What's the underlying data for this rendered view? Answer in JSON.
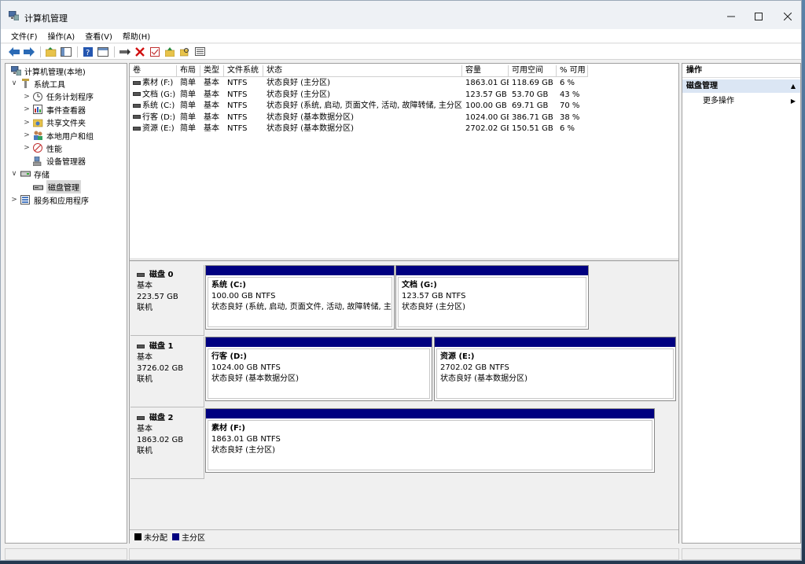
{
  "window": {
    "title": "计算机管理"
  },
  "menu": [
    "文件(F)",
    "操作(A)",
    "查看(V)",
    "帮助(H)"
  ],
  "tree": [
    {
      "label": "计算机管理(本地)",
      "level": 0,
      "expand": "",
      "icon": "computer-icon"
    },
    {
      "label": "系统工具",
      "level": 1,
      "expand": "∨",
      "icon": "tools-icon"
    },
    {
      "label": "任务计划程序",
      "level": 2,
      "expand": ">",
      "icon": "clock-icon"
    },
    {
      "label": "事件查看器",
      "level": 2,
      "expand": ">",
      "icon": "event-viewer-icon"
    },
    {
      "label": "共享文件夹",
      "level": 2,
      "expand": ">",
      "icon": "shared-folder-icon"
    },
    {
      "label": "本地用户和组",
      "level": 2,
      "expand": ">",
      "icon": "users-icon"
    },
    {
      "label": "性能",
      "level": 2,
      "expand": ">",
      "icon": "performance-icon"
    },
    {
      "label": "设备管理器",
      "level": 2,
      "expand": "",
      "icon": "device-manager-icon"
    },
    {
      "label": "存储",
      "level": 1,
      "expand": "∨",
      "icon": "storage-icon"
    },
    {
      "label": "磁盘管理",
      "level": 2,
      "expand": "",
      "icon": "disk-management-icon",
      "selected": true
    },
    {
      "label": "服务和应用程序",
      "level": 1,
      "expand": ">",
      "icon": "services-icon"
    }
  ],
  "volume_table": {
    "headers": [
      "卷",
      "布局",
      "类型",
      "文件系统",
      "状态",
      "容量",
      "可用空间",
      "% 可用"
    ],
    "rows": [
      [
        "素材 (F:)",
        "简单",
        "基本",
        "NTFS",
        "状态良好 (主分区)",
        "1863.01 GB",
        "118.69 GB",
        "6 %"
      ],
      [
        "文档 (G:)",
        "简单",
        "基本",
        "NTFS",
        "状态良好 (主分区)",
        "123.57 GB",
        "53.70 GB",
        "43 %"
      ],
      [
        "系统 (C:)",
        "简单",
        "基本",
        "NTFS",
        "状态良好 (系统, 启动, 页面文件, 活动, 故障转储, 主分区)",
        "100.00 GB",
        "69.71 GB",
        "70 %"
      ],
      [
        "行客 (D:)",
        "简单",
        "基本",
        "NTFS",
        "状态良好 (基本数据分区)",
        "1024.00 GB",
        "386.71 GB",
        "38 %"
      ],
      [
        "资源 (E:)",
        "简单",
        "基本",
        "NTFS",
        "状态良好 (基本数据分区)",
        "2702.02 GB",
        "150.51 GB",
        "6 %"
      ]
    ]
  },
  "disks": [
    {
      "name": "磁盘 0",
      "type": "基本",
      "size": "223.57 GB",
      "status": "联机",
      "partitions": [
        {
          "name": "系统  (C:)",
          "size": "100.00 GB NTFS",
          "status": "状态良好 (系统, 启动, 页面文件, 活动, 故障转储, 主分区)"
        },
        {
          "name": "文档  (G:)",
          "size": "123.57 GB NTFS",
          "status": "状态良好 (主分区)"
        }
      ]
    },
    {
      "name": "磁盘 1",
      "type": "基本",
      "size": "3726.02 GB",
      "status": "联机",
      "partitions": [
        {
          "name": "行客  (D:)",
          "size": "1024.00 GB NTFS",
          "status": "状态良好 (基本数据分区)"
        },
        {
          "name": "资源  (E:)",
          "size": "2702.02 GB NTFS",
          "status": "状态良好 (基本数据分区)"
        }
      ]
    },
    {
      "name": "磁盘 2",
      "type": "基本",
      "size": "1863.02 GB",
      "status": "联机",
      "partitions": [
        {
          "name": "素材  (F:)",
          "size": "1863.01 GB NTFS",
          "status": "状态良好 (主分区)"
        }
      ]
    }
  ],
  "legend": [
    {
      "label": "未分配",
      "color": "#000000"
    },
    {
      "label": "主分区",
      "color": "#000080"
    }
  ],
  "actions": {
    "header": "操作",
    "section": "磁盘管理",
    "item": "更多操作"
  },
  "colors": {
    "partition_bar": "#000080",
    "selection": "#dbe6f4"
  }
}
